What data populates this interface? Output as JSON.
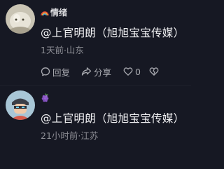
{
  "comments": [
    {
      "username": "情绪",
      "badge_icon": "rainbow-icon",
      "content": "@上官明朗（旭旭宝宝传媒）",
      "meta": "1天前·山东",
      "actions": {
        "reply_label": "回复",
        "share_label": "分享",
        "like_count": "0"
      }
    },
    {
      "username": "",
      "badge_icon": "grapes-emoji-icon",
      "content": "@上官明朗（旭旭宝宝传媒）",
      "meta": "21小时前·江苏"
    }
  ]
}
